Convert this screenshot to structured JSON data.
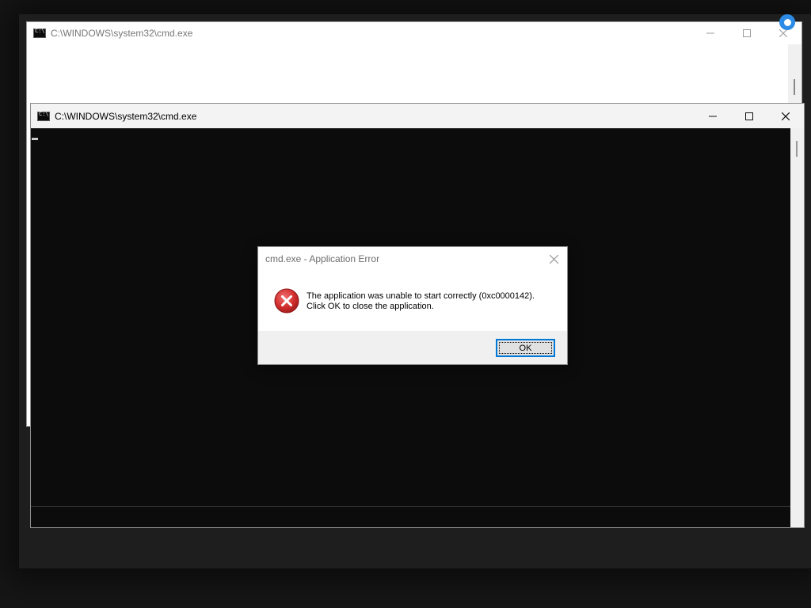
{
  "back_window": {
    "title": "C:\\WINDOWS\\system32\\cmd.exe"
  },
  "front_window": {
    "title": "C:\\WINDOWS\\system32\\cmd.exe"
  },
  "dialog": {
    "title": "cmd.exe - Application Error",
    "message_line1": "The application was unable to start correctly (0xc0000142).",
    "message_line2": "Click OK to close the application.",
    "ok_label": "OK",
    "icon": "error-icon"
  },
  "icons": {
    "minimize": "minimize-icon",
    "maximize": "maximize-icon",
    "close": "close-icon",
    "app": "cmd-icon"
  },
  "colors": {
    "console_bg": "#0c0c0c",
    "error_red": "#d32f2f",
    "accent": "#0078d7"
  }
}
